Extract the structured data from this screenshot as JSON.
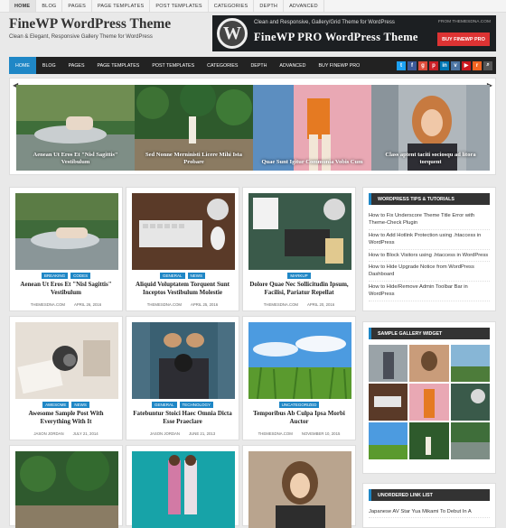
{
  "top_nav": [
    "Home",
    "Blog",
    "Pages",
    "Page Templates",
    "Post Templates",
    "Categories",
    "Depth",
    "Advanced"
  ],
  "site": {
    "title": "FineWP WordPress Theme",
    "tagline": "Clean & Elegant, Responsive Gallery Theme for WordPress"
  },
  "banner": {
    "subtitle": "Clean and Responsive, Gallery/Grid Theme for WordPress",
    "site": "FROM THEMESDNA.COM",
    "headline": "FineWP PRO WordPress Theme",
    "cta": "BUY FINEWP PRO"
  },
  "main_nav": [
    "Home",
    "Blog",
    "Pages",
    "Page Templates",
    "Post Templates",
    "Categories",
    "Depth",
    "Advanced",
    "Buy FineWP Pro"
  ],
  "social_icons": [
    "twitter-icon",
    "facebook-icon",
    "google-plus-icon",
    "pinterest-icon",
    "linkedin-icon",
    "vk-icon",
    "youtube-icon",
    "rss-icon",
    "search-icon"
  ],
  "slides": [
    {
      "caption": "Aenean Ut Eros Et \"Nisl Sagittis\" Vestibulum"
    },
    {
      "caption": "Sed Nonne Merninisti Licere Mihi Ista Probare"
    },
    {
      "caption": "Quae Sunt Igitur Communia Vobis Cum"
    },
    {
      "caption": "Class aptent taciti sociosqu ad litora torquent"
    }
  ],
  "posts": [
    {
      "cats": [
        "Breaking",
        "Codes"
      ],
      "title": "Aenean Ut Eros Et \"Nisl Sagittis\" Vestibulum",
      "author": "Themesdna.com",
      "date": "April 26, 2016"
    },
    {
      "cats": [
        "General",
        "News"
      ],
      "title": "Aliquid Voluptatem Torquent Sunt Inceptos Vestibulum Molestie",
      "author": "Themesdna.com",
      "date": "April 25, 2016"
    },
    {
      "cats": [
        "Markup"
      ],
      "title": "Dolore Quae Nec Sollicitudin Ipsum, Facilisi, Pariatur Repellat",
      "author": "Themesdna.com",
      "date": "April 20, 2016"
    },
    {
      "cats": [
        "Awesome",
        "News"
      ],
      "title": "Awesome Sample Post With Everything With It",
      "author": "Jason Jordan",
      "date": "July 21, 2014"
    },
    {
      "cats": [
        "General",
        "Technology"
      ],
      "title": "Fatebuntur Stoici Haec Omnia Dicta Esse Praeclare",
      "author": "Jason Jordan",
      "date": "June 21, 2013"
    },
    {
      "cats": [
        "Uncategorized"
      ],
      "title": "Temporibus Ab Culpa Ipsa Morbi Auctor",
      "author": "Themesdna.com",
      "date": "November 10, 2015"
    }
  ],
  "widgets": {
    "tips": {
      "title": "WordPress Tips & Tutorials",
      "items": [
        "How to Fix Underscore Theme Title Error with Theme-Check Plugin",
        "How to Add Hotlink Protection using .htaccess in WordPress",
        "How to Block Visitors using .htaccess in WordPress",
        "How to Hide Upgrade Notice from WordPress Dashboard",
        "How to Hide/Remove Admin Toolbar Bar in WordPress"
      ]
    },
    "gallery": {
      "title": "Sample Gallery Widget"
    },
    "links": {
      "title": "Unordered Link List",
      "items": [
        "Japanese AV Star Yua Mikami To Debut In A"
      ]
    }
  },
  "colors": {
    "accent": "#1f87c6",
    "dark": "#222222",
    "cta": "#dd3333"
  }
}
